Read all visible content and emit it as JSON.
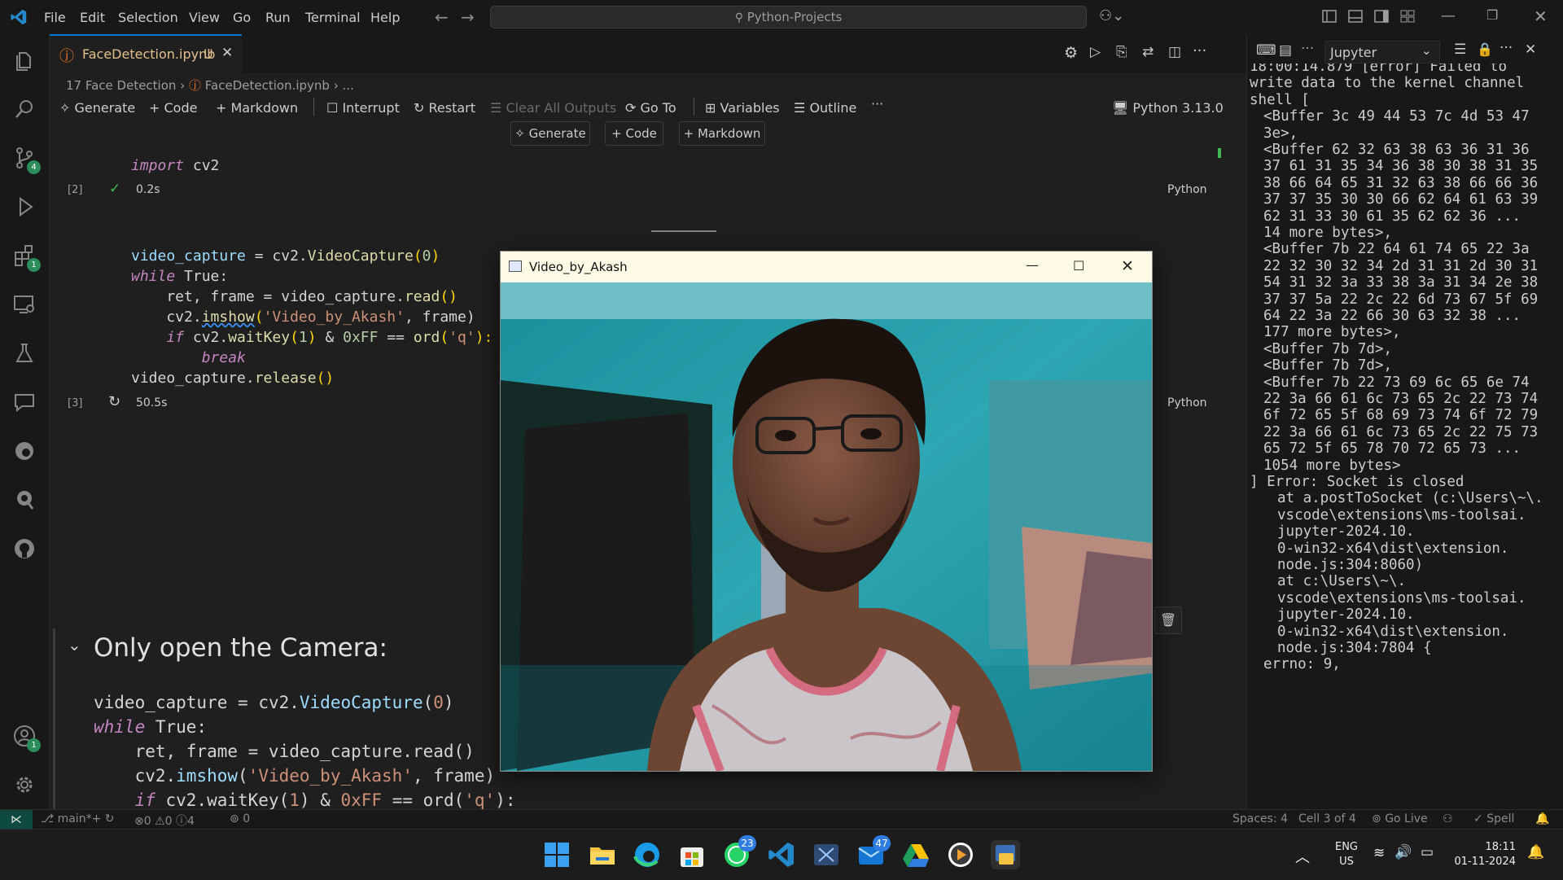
{
  "menu": [
    "File",
    "Edit",
    "Selection",
    "View",
    "Go",
    "Run",
    "Terminal",
    "Help"
  ],
  "search": {
    "text": "Python-Projects"
  },
  "tab": {
    "label": "FaceDetection.ipynb",
    "status": "U"
  },
  "breadcrumb": {
    "folder": "17 Face Detection",
    "file": "FaceDetection.ipynb",
    "more": "..."
  },
  "toolbar": {
    "generate": "Generate",
    "code": "Code",
    "markdown": "Markdown",
    "interrupt": "Interrupt",
    "restart": "Restart",
    "clear": "Clear All Outputs",
    "goto": "Go To",
    "variables": "Variables",
    "outline": "Outline",
    "more": "···",
    "kernel": "Python 3.13.0"
  },
  "insert": {
    "generate": "Generate",
    "code": "Code",
    "markdown": "Markdown"
  },
  "cell1": {
    "exec": "[2]",
    "time": "0.2s",
    "lang": "Python",
    "line1_kw": "import",
    "line1_mod": "cv2"
  },
  "cell2": {
    "exec": "[3]",
    "time": "50.5s",
    "lang": "Python",
    "t": {
      "video_capture": "video_capture",
      "eq": " = ",
      "cv2dot": "cv2.",
      "VideoCapture": "VideoCapture",
      "lp": "(",
      "zero": "0",
      "rp": ")",
      "while": "while",
      "true": " True:",
      "ret": "    ret, frame = video_capture.",
      "read": "read",
      "parens": "()",
      "imshow_pre": "    cv2.",
      "imshow": "imshow",
      "imshow_args_pre": "(",
      "title_str": "'Video_by_Akash'",
      "imshow_args_post": ", frame)",
      "if": "    if",
      "wait_pre": " cv2.",
      "waitKey": "waitKey",
      "one": "1",
      "amp": " & ",
      "hex": "0xFF",
      "eqeq": " == ",
      "ord": "ord",
      "q": "'q'",
      "colon": "):",
      "brk": "        break",
      "release_pre": "video_capture.",
      "release": "release"
    }
  },
  "md_heading": "Only open the Camera:",
  "video_window": {
    "title": "Video_by_Akash"
  },
  "panel": {
    "title": "Jupyter"
  },
  "output_lines": [
    {
      "i": 0,
      "t": "18:00:14.879 [error] Failed to"
    },
    {
      "i": 0,
      "t": "write data to the kernel channel"
    },
    {
      "i": 0,
      "t": "shell ["
    },
    {
      "i": 1,
      "t": "<Buffer 3c 49 44 53 7c 4d 53 47"
    },
    {
      "i": 1,
      "t": "3e>,"
    },
    {
      "i": 1,
      "t": "<Buffer 62 32 63 38 63 36 31 36"
    },
    {
      "i": 1,
      "t": "37 61 31 35 34 36 38 30 38 31 35"
    },
    {
      "i": 1,
      "t": "38 66 64 65 31 32 63 38 66 66 36"
    },
    {
      "i": 1,
      "t": "37 37 35 30 30 66 62 64 61 63 39"
    },
    {
      "i": 1,
      "t": "62 31 33 30 61 35 62 62 36 ..."
    },
    {
      "i": 1,
      "t": "14 more bytes>,"
    },
    {
      "i": 1,
      "t": "<Buffer 7b 22 64 61 74 65 22 3a"
    },
    {
      "i": 1,
      "t": "22 32 30 32 34 2d 31 31 2d 30 31"
    },
    {
      "i": 1,
      "t": "54 31 32 3a 33 38 3a 31 34 2e 38"
    },
    {
      "i": 1,
      "t": "37 37 5a 22 2c 22 6d 73 67 5f 69"
    },
    {
      "i": 1,
      "t": "64 22 3a 22 66 30 63 32 38 ..."
    },
    {
      "i": 1,
      "t": "177 more bytes>,"
    },
    {
      "i": 1,
      "t": "<Buffer 7b 7d>,"
    },
    {
      "i": 1,
      "t": "<Buffer 7b 7d>,"
    },
    {
      "i": 1,
      "t": "<Buffer 7b 22 73 69 6c 65 6e 74"
    },
    {
      "i": 1,
      "t": "22 3a 66 61 6c 73 65 2c 22 73 74"
    },
    {
      "i": 1,
      "t": "6f 72 65 5f 68 69 73 74 6f 72 79"
    },
    {
      "i": 1,
      "t": "22 3a 66 61 6c 73 65 2c 22 75 73"
    },
    {
      "i": 1,
      "t": "65 72 5f 65 78 70 72 65 73 ..."
    },
    {
      "i": 1,
      "t": "1054 more bytes>"
    },
    {
      "i": 0,
      "t": "] Error: Socket is closed"
    },
    {
      "i": 2,
      "t": "at a.postToSocket (c:\\Users\\~\\."
    },
    {
      "i": 2,
      "t": "vscode\\extensions\\ms-toolsai."
    },
    {
      "i": 2,
      "t": "jupyter-2024.10."
    },
    {
      "i": 2,
      "t": "0-win32-x64\\dist\\extension."
    },
    {
      "i": 2,
      "t": "node.js:304:8060)"
    },
    {
      "i": 2,
      "t": "at c:\\Users\\~\\."
    },
    {
      "i": 2,
      "t": "vscode\\extensions\\ms-toolsai."
    },
    {
      "i": 2,
      "t": "jupyter-2024.10."
    },
    {
      "i": 2,
      "t": "0-win32-x64\\dist\\extension."
    },
    {
      "i": 2,
      "t": "node.js:304:7804 {"
    },
    {
      "i": 1,
      "t": "errno: 9,"
    }
  ],
  "status": {
    "branch": "main*+",
    "errors": "0",
    "warnings": "0",
    "info": "4",
    "ports": "0",
    "spaces": "Spaces: 4",
    "cell": "Cell 3 of 4",
    "golive": "Go Live",
    "spell": "Spell"
  },
  "badges": {
    "scm": "4",
    "extensions": "1",
    "accounts": "1"
  },
  "taskbar": {
    "whatsapp_badge": "23",
    "mail_badge": "47",
    "lang1": "ENG",
    "lang2": "US",
    "time": "18:11",
    "date": "01-11-2024"
  },
  "colors": {
    "accent": "#0078d4",
    "badge_green": "#2b8d5a",
    "taskbar": "#1c1c1c",
    "editor": "#1f1f1f"
  }
}
